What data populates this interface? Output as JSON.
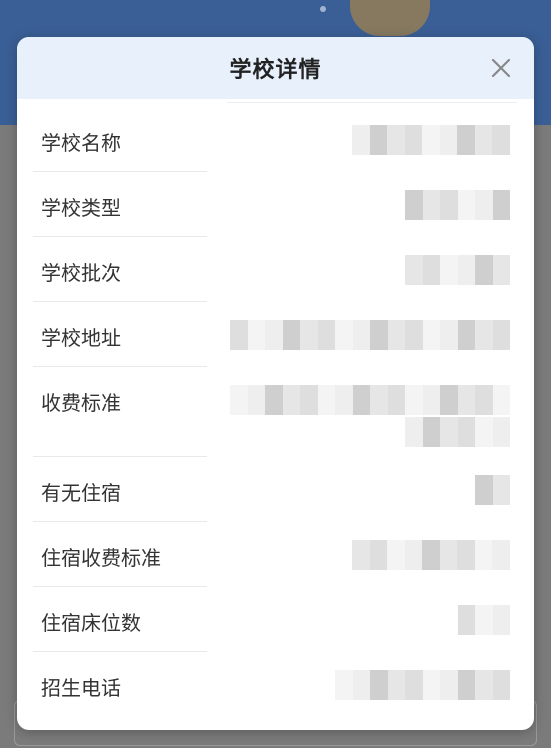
{
  "dialog": {
    "title": "学校详情",
    "close_icon": "close-icon"
  },
  "fields": [
    {
      "label": "学校名称"
    },
    {
      "label": "学校类型"
    },
    {
      "label": "学校批次"
    },
    {
      "label": "学校地址"
    },
    {
      "label": "收费标准"
    },
    {
      "label": "有无住宿"
    },
    {
      "label": "住宿收费标准"
    },
    {
      "label": "住宿床位数"
    },
    {
      "label": "招生电话"
    }
  ],
  "colors": {
    "header_bg": "#e7f0fb",
    "overlay": "#7b7b7b",
    "redaction_light": "#eeeeee",
    "redaction_mid": "#dedede",
    "redaction_dark": "#cfcfcf"
  }
}
